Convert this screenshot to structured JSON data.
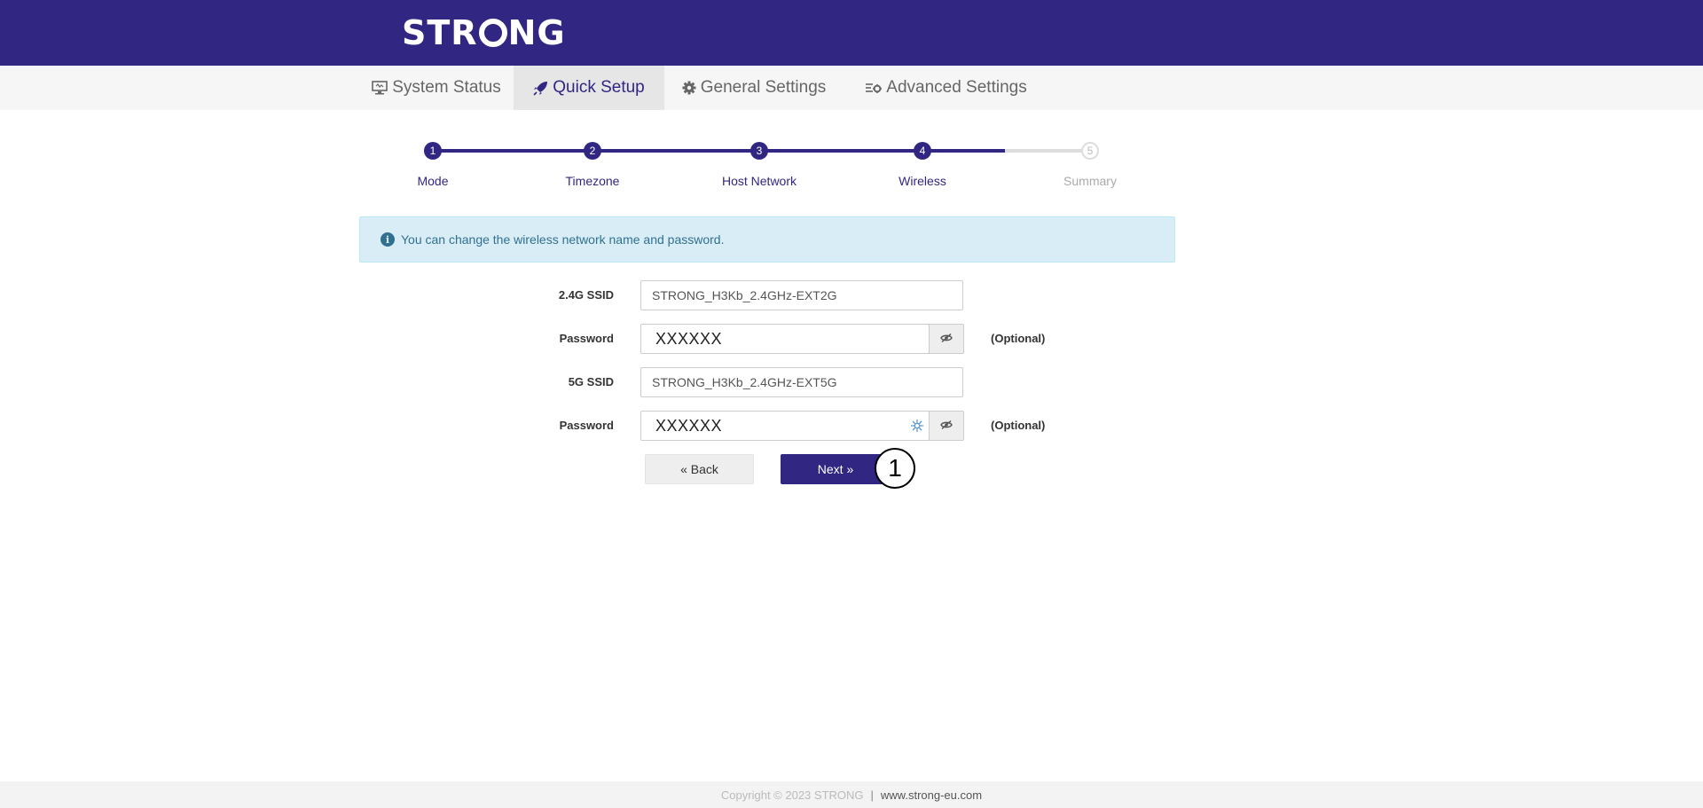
{
  "brand": {
    "logo_text_left": "STR",
    "logo_text_right": "NG",
    "colors": {
      "primary": "#312783",
      "alert_bg": "#d9edf7",
      "alert_text": "#31708f"
    }
  },
  "nav": {
    "tabs": [
      {
        "label": "System Status",
        "icon": "monitor-icon",
        "active": false
      },
      {
        "label": "Quick Setup",
        "icon": "rocket-icon",
        "active": true
      },
      {
        "label": "General Settings",
        "icon": "gear-icon",
        "active": false
      },
      {
        "label": "Advanced Settings",
        "icon": "sliders-icon",
        "active": false
      }
    ]
  },
  "steps": [
    {
      "num": "1",
      "label": "Mode",
      "done": true
    },
    {
      "num": "2",
      "label": "Timezone",
      "done": true
    },
    {
      "num": "3",
      "label": "Host Network",
      "done": true
    },
    {
      "num": "4",
      "label": "Wireless",
      "done": true
    },
    {
      "num": "5",
      "label": "Summary",
      "done": false
    }
  ],
  "alert": {
    "icon": "info-icon",
    "text": "You can change the wireless network name and password."
  },
  "form": {
    "ssid24_label": "2.4G SSID",
    "ssid24_value": "STRONG_H3Kb_2.4GHz-EXT2G",
    "pw24_label": "Password",
    "pw24_value": "XXXXXX",
    "pw24_optional": "(Optional)",
    "ssid5_label": "5G SSID",
    "ssid5_value": "STRONG_H3Kb_2.4GHz-EXT5G",
    "pw5_label": "Password",
    "pw5_value": "XXXXXX",
    "pw5_optional": "(Optional)"
  },
  "buttons": {
    "back": "« Back",
    "next": "Next »"
  },
  "annotation": {
    "marker": "1"
  },
  "footer": {
    "copyright": "Copyright © 2023 STRONG",
    "separator": "|",
    "link": "www.strong-eu.com"
  }
}
